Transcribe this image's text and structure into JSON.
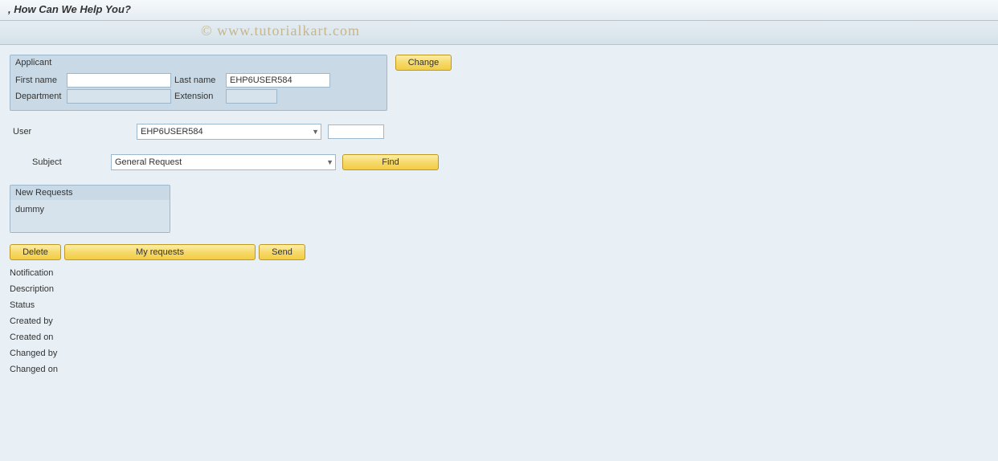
{
  "title": ", How Can We Help You?",
  "watermark": "© www.tutorialkart.com",
  "applicant": {
    "group_label": "Applicant",
    "first_name_label": "First name",
    "first_name_value": "",
    "last_name_label": "Last name",
    "last_name_value": "EHP6USER584",
    "department_label": "Department",
    "department_value": "",
    "extension_label": "Extension",
    "extension_value": ""
  },
  "buttons": {
    "change": "Change",
    "find": "Find",
    "delete": "Delete",
    "my_requests": "My requests",
    "send": "Send"
  },
  "user": {
    "label": "User",
    "value": "EHP6USER584",
    "extra_value": ""
  },
  "subject": {
    "label": "Subject",
    "value": "General Request"
  },
  "new_requests": {
    "label": "New Requests",
    "items": [
      "dummy"
    ]
  },
  "details": {
    "notification": "Notification",
    "description": "Description",
    "status": "Status",
    "created_by": "Created by",
    "created_on": "Created on",
    "changed_by": "Changed by",
    "changed_on": "Changed on"
  }
}
